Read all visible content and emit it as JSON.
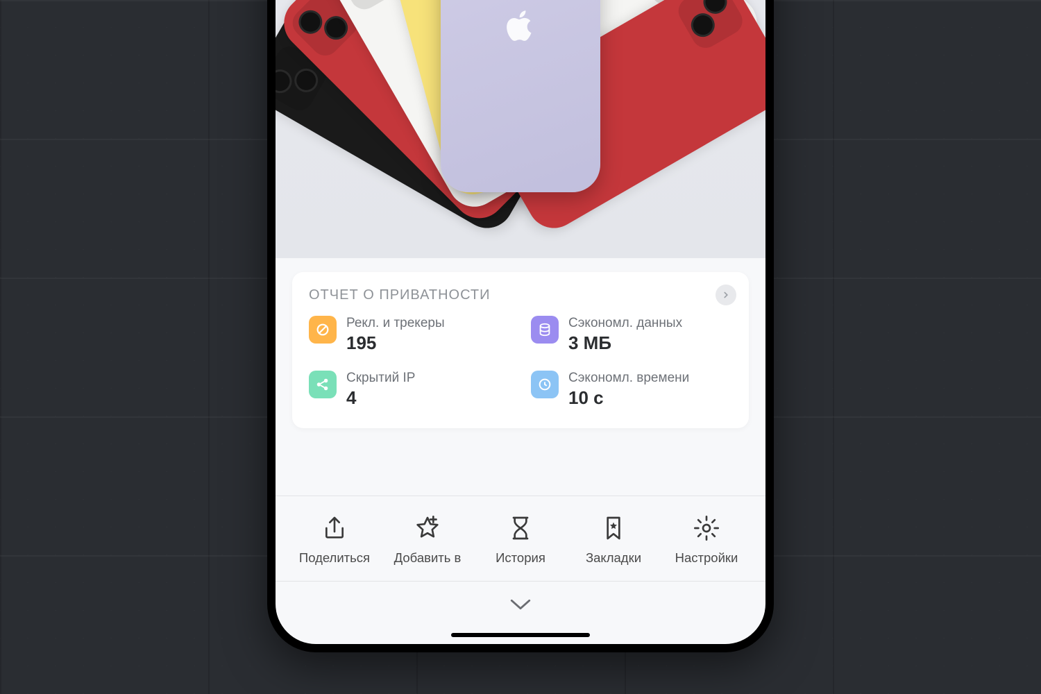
{
  "report": {
    "title": "ОТЧЕТ О ПРИВАТНОСТИ",
    "stats": [
      {
        "label": "Рекл. и трекеры",
        "value": "195",
        "color": "orange"
      },
      {
        "label": "Сэкономл. данных",
        "value": "3 МБ",
        "color": "purple"
      },
      {
        "label": "Скрытий IP",
        "value": "4",
        "color": "mint"
      },
      {
        "label": "Сэкономл. времени",
        "value": "10 с",
        "color": "blue"
      }
    ]
  },
  "toolbar": [
    {
      "label": "Поделиться",
      "icon": "share"
    },
    {
      "label": "Добавить в",
      "icon": "star-add"
    },
    {
      "label": "История",
      "icon": "hourglass"
    },
    {
      "label": "Закладки",
      "icon": "bookmark"
    },
    {
      "label": "Настройки",
      "icon": "gear"
    }
  ]
}
